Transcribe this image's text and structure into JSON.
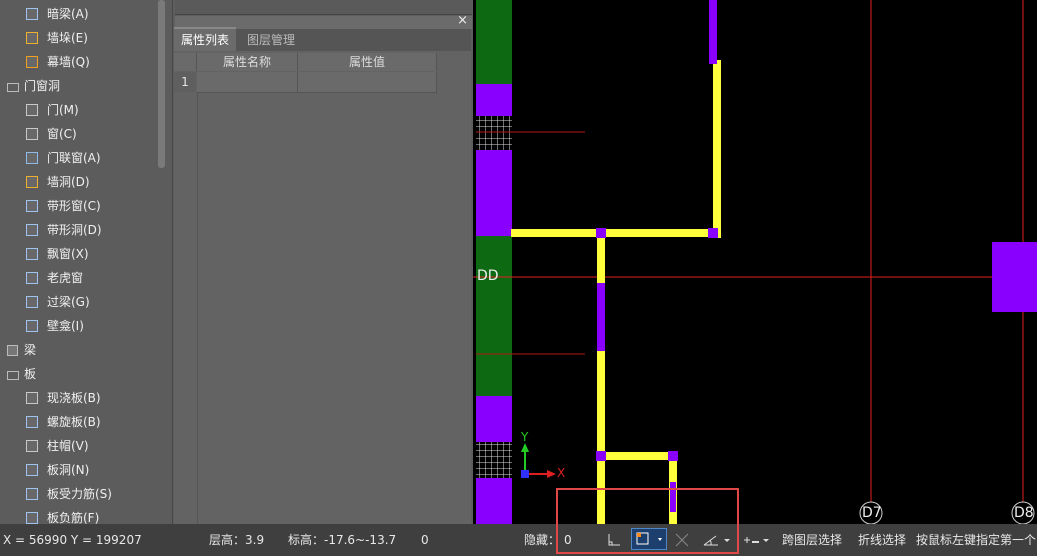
{
  "tree": {
    "items": [
      {
        "label": "暗梁(A)",
        "level": 1,
        "icon": "hidden-beam-icon"
      },
      {
        "label": "墙垛(E)",
        "level": 1,
        "icon": "wall-pier-icon"
      },
      {
        "label": "幕墙(Q)",
        "level": 1,
        "icon": "curtain-wall-icon"
      },
      {
        "label": "门窗洞",
        "level": 0,
        "icon": "folder-icon",
        "expanded": true
      },
      {
        "label": "门(M)",
        "level": 1,
        "icon": "door-icon"
      },
      {
        "label": "窗(C)",
        "level": 1,
        "icon": "window-icon"
      },
      {
        "label": "门联窗(A)",
        "level": 1,
        "icon": "door-window-icon"
      },
      {
        "label": "墙洞(D)",
        "level": 1,
        "icon": "wall-opening-icon"
      },
      {
        "label": "带形窗(C)",
        "level": 1,
        "icon": "strip-window-icon"
      },
      {
        "label": "带形洞(D)",
        "level": 1,
        "icon": "strip-opening-icon"
      },
      {
        "label": "飘窗(X)",
        "level": 1,
        "icon": "bay-window-icon"
      },
      {
        "label": "老虎窗",
        "level": 1,
        "icon": "dormer-icon"
      },
      {
        "label": "过梁(G)",
        "level": 1,
        "icon": "lintel-icon"
      },
      {
        "label": "壁龛(I)",
        "level": 1,
        "icon": "niche-icon"
      },
      {
        "label": "梁",
        "level": 0,
        "icon": "folder-icon",
        "expanded": false
      },
      {
        "label": "板",
        "level": 0,
        "icon": "folder-icon",
        "expanded": true
      },
      {
        "label": "现浇板(B)",
        "level": 1,
        "icon": "cast-slab-icon"
      },
      {
        "label": "螺旋板(B)",
        "level": 1,
        "icon": "spiral-slab-icon"
      },
      {
        "label": "柱帽(V)",
        "level": 1,
        "icon": "column-cap-icon"
      },
      {
        "label": "板洞(N)",
        "level": 1,
        "icon": "slab-hole-icon"
      },
      {
        "label": "板受力筋(S)",
        "level": 1,
        "icon": "slab-rebar-icon"
      },
      {
        "label": "板负筋(F)",
        "level": 1,
        "icon": "slab-neg-rebar-icon"
      }
    ]
  },
  "props": {
    "close": "×",
    "tabs": [
      "属性列表",
      "图层管理"
    ],
    "columns": [
      "属性名称",
      "属性值"
    ],
    "rows": [
      "1"
    ]
  },
  "canvas": {
    "axis_labels": [
      "DD",
      "D7",
      "D8"
    ],
    "ucs": {
      "y": "Y",
      "x": "X"
    }
  },
  "status": {
    "coords": "X = 56990 Y = 199207",
    "floor_height": "层高：3.9",
    "elevation": "标高：-17.6~-13.7",
    "zero": "0",
    "hidden_label": "隐藏：",
    "hidden_value": "0",
    "cross_layer": "跨图层选择",
    "polyline_select": "折线选择",
    "hint": "按鼠标左键指定第一个"
  },
  "colors": {
    "wall": "#ffff3c",
    "column": "#8a00ff",
    "axis": "#e02020",
    "green": "#0e6a12",
    "tree_bg": "#5c5c5c"
  }
}
